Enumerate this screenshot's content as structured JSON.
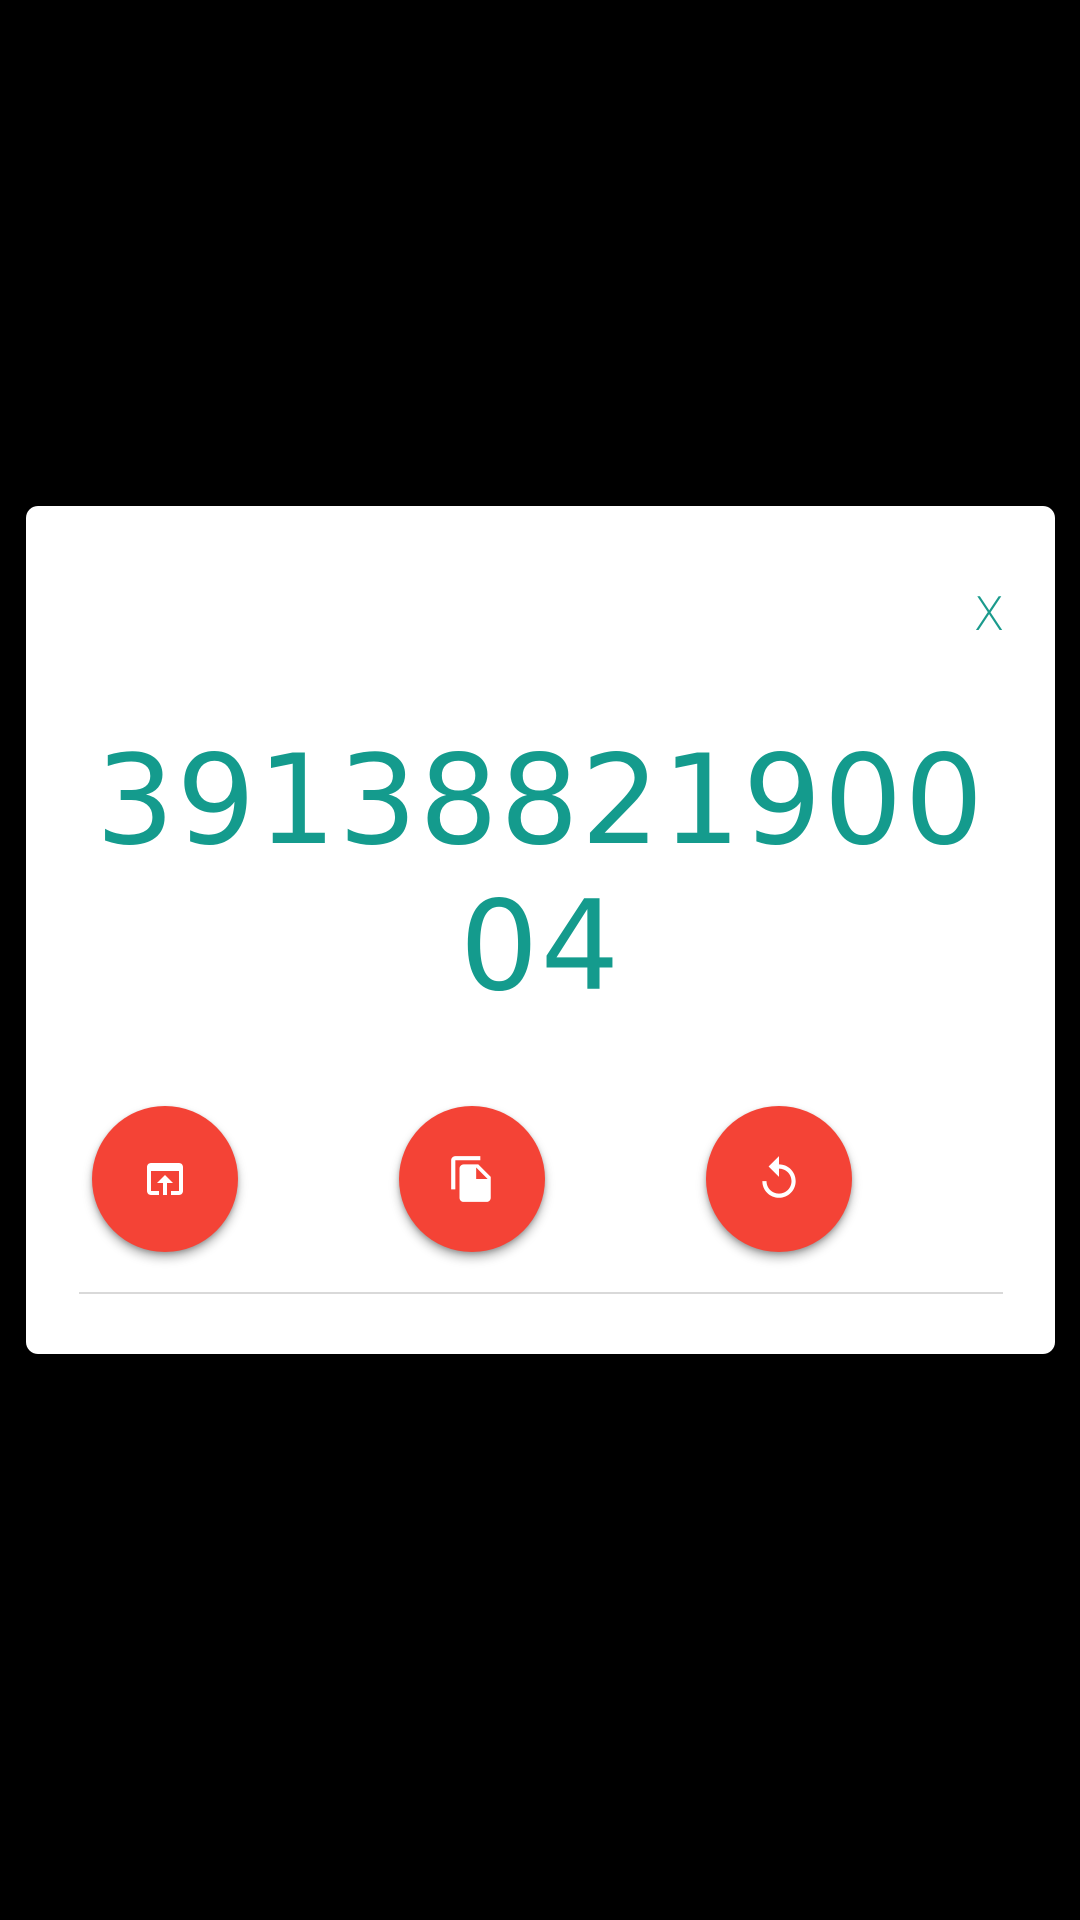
{
  "dialog": {
    "close_label": "X",
    "number_value": "3913882190004"
  },
  "actions": [
    {
      "icon": "open-in-browser-icon",
      "action": "open"
    },
    {
      "icon": "copy-icon",
      "action": "copy"
    },
    {
      "icon": "restore-icon",
      "action": "reset"
    }
  ],
  "colors": {
    "background": "#000000",
    "dialog": "#ffffff",
    "accent_teal": "#149b8d",
    "fab_red": "#f44336",
    "divider": "#d9d9d9"
  }
}
